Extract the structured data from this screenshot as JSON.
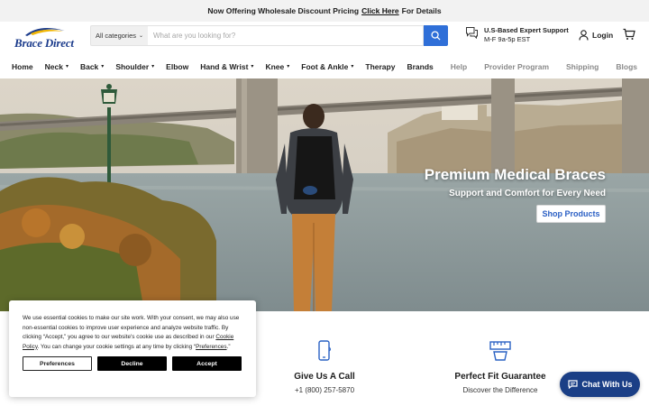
{
  "announcement": {
    "before": "Now Offering Wholesale Discount Pricing",
    "link": "Click Here",
    "after": "For Details"
  },
  "header": {
    "logo_text": "Brace Direct",
    "category_select": "All categories",
    "search_placeholder": "What are you looking for?",
    "support_title": "U.S-Based Expert Support",
    "support_hours": "M-F 9a-5p EST",
    "login_label": "Login"
  },
  "nav": {
    "left": [
      {
        "label": "Home",
        "dropdown": false
      },
      {
        "label": "Neck",
        "dropdown": true
      },
      {
        "label": "Back",
        "dropdown": true
      },
      {
        "label": "Shoulder",
        "dropdown": true
      },
      {
        "label": "Elbow",
        "dropdown": false
      },
      {
        "label": "Hand & Wrist",
        "dropdown": true
      },
      {
        "label": "Knee",
        "dropdown": true
      },
      {
        "label": "Foot & Ankle",
        "dropdown": true
      },
      {
        "label": "Therapy",
        "dropdown": false
      },
      {
        "label": "Brands",
        "dropdown": false
      }
    ],
    "right": [
      "Help",
      "Provider Program",
      "Shipping",
      "Blogs"
    ]
  },
  "hero": {
    "title": "Premium Medical Braces",
    "subtitle": "Support and Comfort for Every Need",
    "button": "Shop Products"
  },
  "features": {
    "call_title": "Give Us A Call",
    "call_phone": "+1 (800) 257-5870",
    "fit_title": "Perfect Fit Guarantee",
    "fit_sub": "Discover the Difference"
  },
  "cookie": {
    "text_1": "We use essential cookies to make our site work. With your consent, we may also use non-essential cookies to improve user experience and analyze website traffic. By clicking “Accept,” you agree to our website's cookie use as described in our ",
    "policy_link": "Cookie Policy",
    "text_2": ". You can change your cookie settings at any time by clicking “",
    "preferences_link": "Preferences",
    "text_3": ".”",
    "btn_preferences": "Preferences",
    "btn_decline": "Decline",
    "btn_accept": "Accept"
  },
  "chat": {
    "label": "Chat With Us"
  },
  "colors": {
    "accent_blue": "#2f6fd8",
    "chat_navy": "#1b3f86",
    "logo_navy": "#1c3c8c",
    "logo_gold": "#f2b705"
  }
}
